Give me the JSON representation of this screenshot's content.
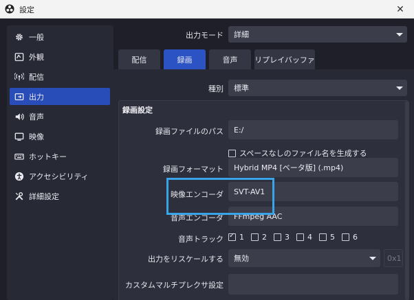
{
  "window": {
    "title": "設定",
    "close_glyph": "✕"
  },
  "sidebar": {
    "items": [
      {
        "label": "一般",
        "icon": "gear-icon"
      },
      {
        "label": "外観",
        "icon": "palette-icon"
      },
      {
        "label": "配信",
        "icon": "broadcast-icon"
      },
      {
        "label": "出力",
        "icon": "output-icon",
        "active": true
      },
      {
        "label": "音声",
        "icon": "speaker-icon"
      },
      {
        "label": "映像",
        "icon": "monitor-icon"
      },
      {
        "label": "ホットキー",
        "icon": "keyboard-icon"
      },
      {
        "label": "アクセシビリティ",
        "icon": "accessibility-icon"
      },
      {
        "label": "詳細設定",
        "icon": "tools-icon"
      }
    ]
  },
  "output_mode": {
    "label": "出力モード",
    "value": "詳細"
  },
  "tabs": [
    {
      "label": "配信"
    },
    {
      "label": "録画",
      "active": true
    },
    {
      "label": "音声"
    },
    {
      "label": "リプレイバッファ"
    }
  ],
  "type_row": {
    "label": "種別",
    "value": "標準"
  },
  "recording": {
    "group_title": "録画設定",
    "path_label": "録画ファイルのパス",
    "path_value": "E:/",
    "nospace_label": "スペースなしのファイル名を生成する",
    "format_label": "録画フォーマット",
    "format_value": "Hybrid MP4 [ベータ版] (.mp4)",
    "video_encoder_label": "映像エンコーダ",
    "video_encoder_value": "SVT-AV1",
    "audio_encoder_label": "音声エンコーダ",
    "audio_encoder_value": "FFmpeg AAC",
    "audio_track_label": "音声トラック",
    "tracks": [
      "1",
      "2",
      "3",
      "4",
      "5",
      "6"
    ],
    "rescale_label": "出力をリスケールする",
    "rescale_value": "無効",
    "rescale_res_placeholder": "0x1",
    "muxer_label": "カスタムマルチプレクサ設定"
  },
  "colors": {
    "accent": "#2b53c4",
    "highlight": "#3aa4e8",
    "background": "#1e1f29"
  }
}
